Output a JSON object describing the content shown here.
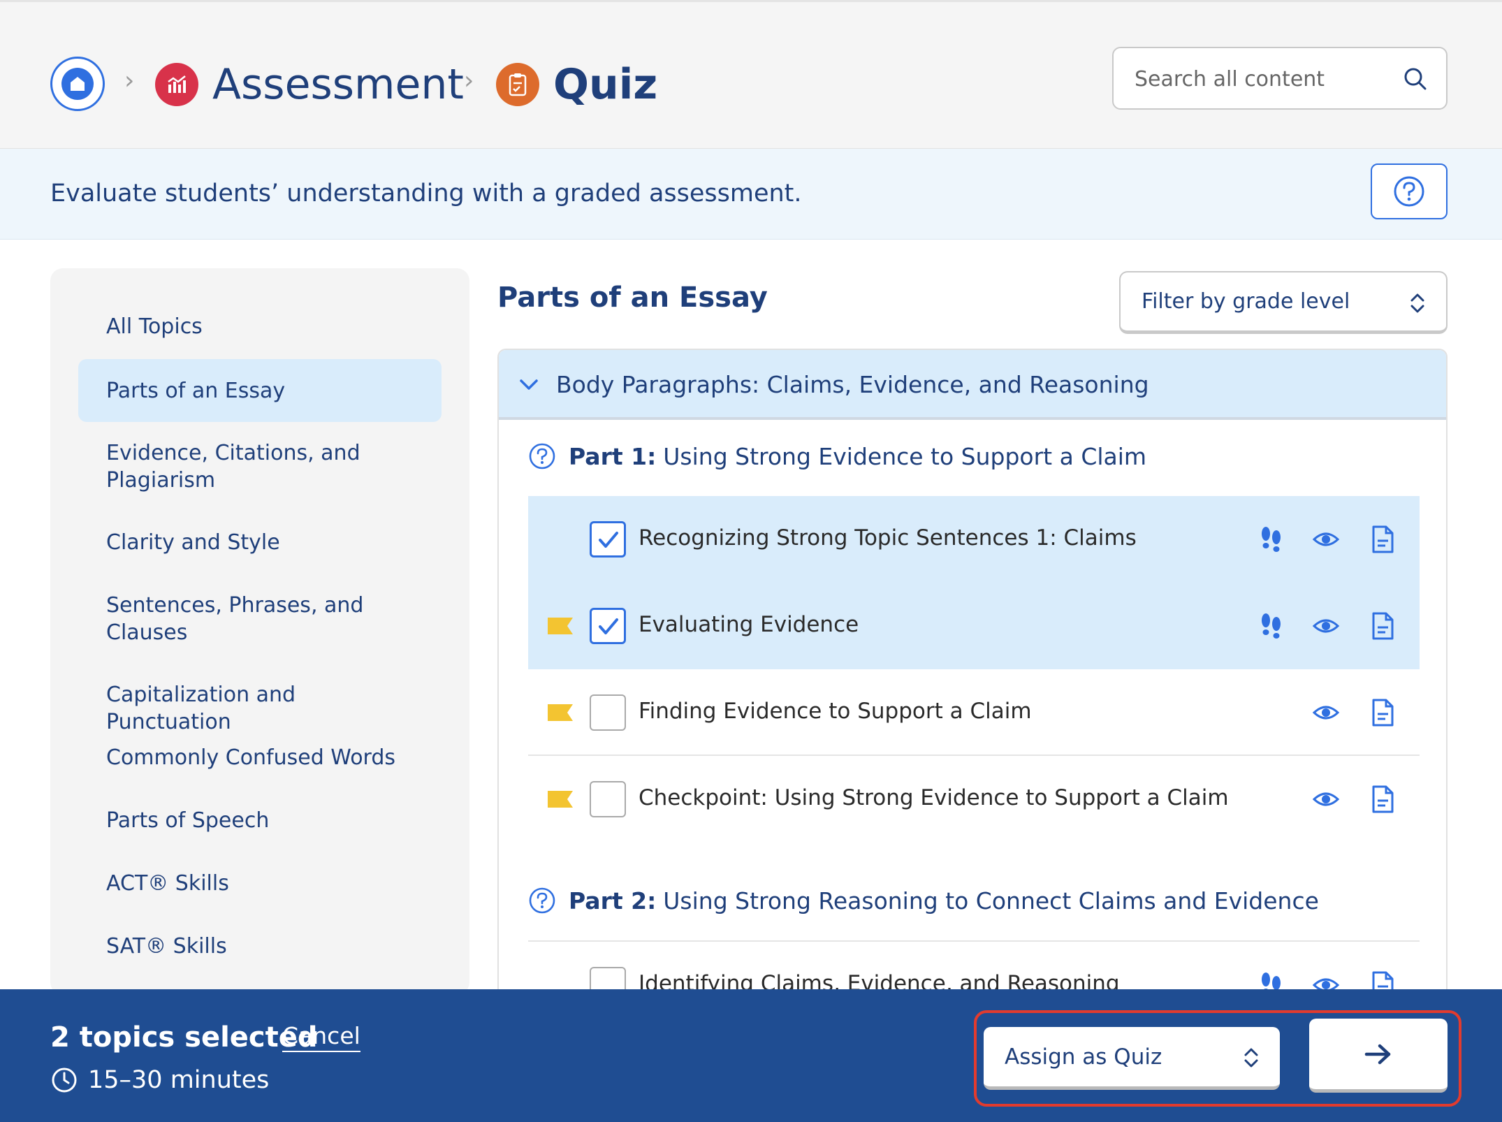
{
  "breadcrumb": {
    "home_icon": "home-icon",
    "items": [
      {
        "label": "Assessment",
        "icon": "chart-icon",
        "color": "#d8324a"
      },
      {
        "label": "Quiz",
        "icon": "clipboard-icon",
        "color": "#dd6b2c"
      }
    ]
  },
  "search": {
    "placeholder": "Search all content"
  },
  "banner": {
    "text": "Evaluate students’ understanding with a graded assessment."
  },
  "sidebar": {
    "items": [
      {
        "label": "All Topics",
        "active": false
      },
      {
        "label": "Parts of an Essay",
        "active": true
      },
      {
        "label": "Evidence, Citations, and Plagiarism",
        "active": false
      },
      {
        "label": "Clarity and Style",
        "active": false
      },
      {
        "label": "Sentences, Phrases, and Clauses",
        "active": false
      },
      {
        "label": "Capitalization and Punctuation",
        "active": false
      },
      {
        "label": "Commonly Confused Words",
        "active": false
      },
      {
        "label": "Parts of Speech",
        "active": false
      },
      {
        "label": "ACT® Skills",
        "active": false
      },
      {
        "label": "SAT® Skills",
        "active": false
      }
    ]
  },
  "main": {
    "title": "Parts of an Essay",
    "filter_label": "Filter by grade level",
    "section": {
      "title": "Body Paragraphs: Claims, Evidence, and Reasoning"
    },
    "parts": [
      {
        "prefix": "Part 1:",
        "title": "Using Strong Evidence to Support a Claim",
        "rows": [
          {
            "label": "Recognizing Strong Topic Sentences 1: Claims",
            "checked": true,
            "flag": false,
            "footsteps": true
          },
          {
            "label": "Evaluating Evidence",
            "checked": true,
            "flag": true,
            "footsteps": true
          },
          {
            "label": "Finding Evidence to Support a Claim",
            "checked": false,
            "flag": true,
            "footsteps": false
          },
          {
            "label": "Checkpoint: Using Strong Evidence to Support a Claim",
            "checked": false,
            "flag": true,
            "footsteps": false
          }
        ]
      },
      {
        "prefix": "Part 2:",
        "title": "Using Strong Reasoning to Connect Claims and Evidence",
        "rows": [
          {
            "label": "Identifying Claims, Evidence, and Reasoning",
            "checked": false,
            "flag": false,
            "footsteps": true
          }
        ]
      }
    ]
  },
  "footer": {
    "selected_text": "2 topics selected",
    "cancel_label": "Cancel",
    "duration": "15–30 minutes",
    "assign_label": "Assign as Quiz",
    "go_icon": "arrow-right-icon"
  },
  "colors": {
    "accent": "#2f6fe0",
    "navy": "#1f3f7a",
    "footer": "#1f4d92",
    "selected_row": "#d9ecfb",
    "flag": "#f3c431",
    "highlight": "#e23b2e"
  }
}
